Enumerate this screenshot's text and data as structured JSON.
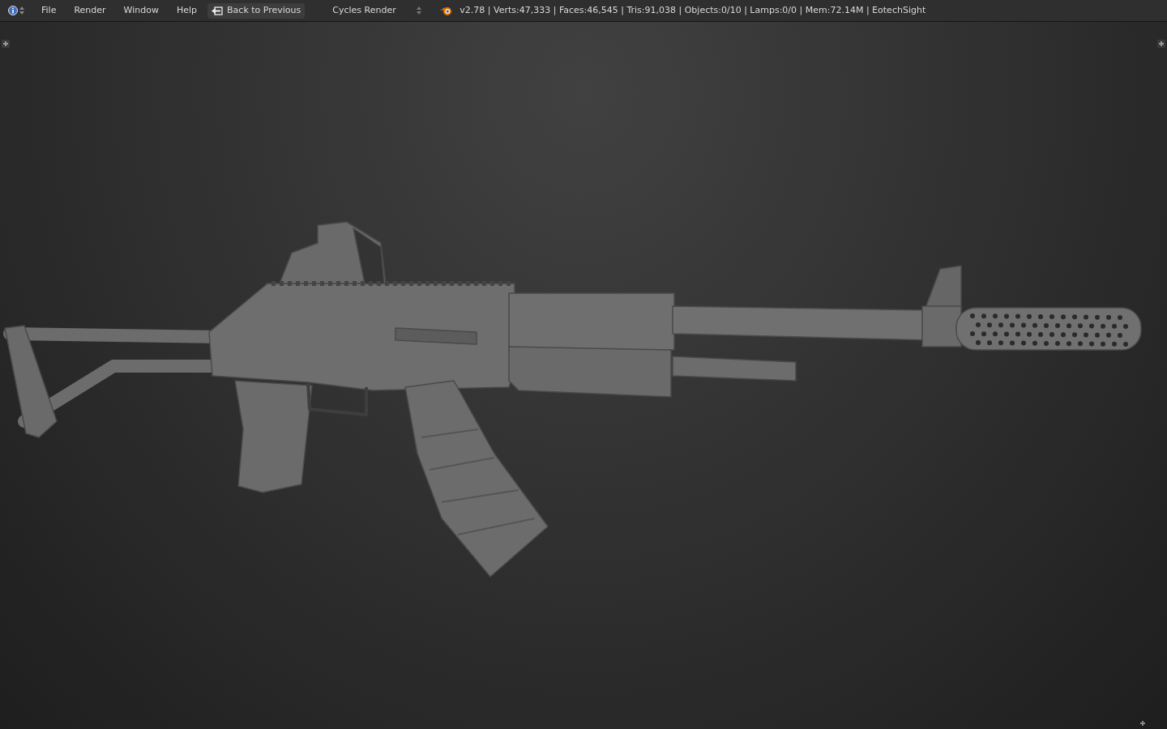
{
  "header": {
    "menus": [
      "File",
      "Render",
      "Window",
      "Help"
    ],
    "back_button": "Back to Previous",
    "render_engine": "Cycles Render",
    "stats": "v2.78 | Verts:47,333 | Faces:46,545 | Tris:91,038 | Objects:0/10 | Lamps:0/0 | Mem:72.14M | EotechSight"
  }
}
